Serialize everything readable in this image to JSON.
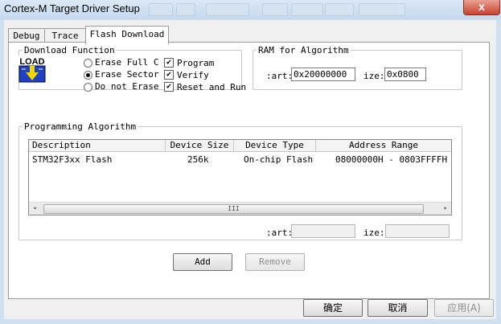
{
  "window": {
    "title": "Cortex-M Target Driver Setup",
    "close_label": "x"
  },
  "tabs": [
    "Debug",
    "Trace",
    "Flash Download"
  ],
  "download_function": {
    "legend": "Download Function",
    "load_label": "LOAD",
    "radios": [
      "Erase Full C",
      "Erase Sector",
      "Do not Erase"
    ],
    "checks": [
      "Program",
      "Verify",
      "Reset and Run"
    ],
    "check_mark": "✔"
  },
  "ram": {
    "legend": "RAM for Algorithm",
    "start_label": ":art:",
    "start_value": "0x20000000",
    "size_label": "ize:",
    "size_value": "0x0800"
  },
  "programming": {
    "legend": "Programming Algorithm",
    "columns": [
      "Description",
      "Device Size",
      "Device Type",
      "Address Range"
    ],
    "rows": [
      [
        "STM32F3xx Flash",
        "256k",
        "On-chip Flash",
        "08000000H - 0803FFFFH"
      ]
    ],
    "scroll_left": "◂",
    "scroll_right": "▸",
    "scroll_grip": "III",
    "start_label": ":art:",
    "size_label": "ize:"
  },
  "buttons": {
    "add": "Add",
    "remove": "Remove",
    "ok": "确定",
    "cancel": "取消",
    "apply": "应用(A)"
  }
}
